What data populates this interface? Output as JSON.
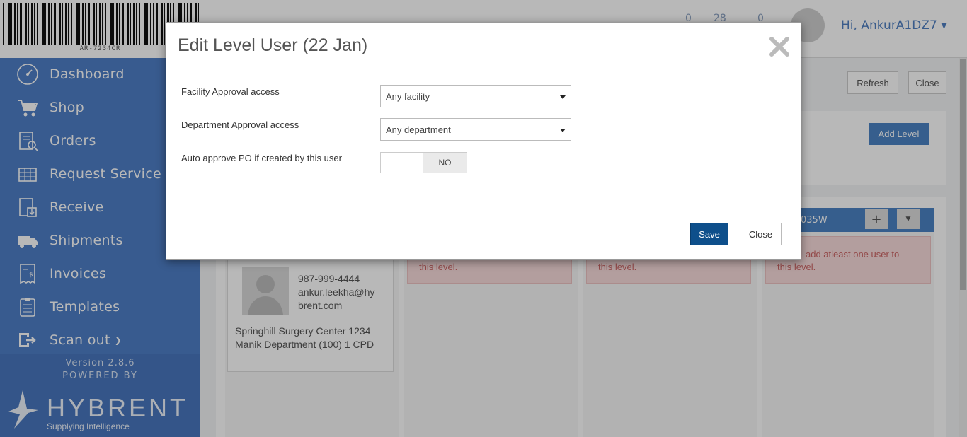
{
  "app": {
    "barcode_text": "AR-7234CR",
    "greeting": "Hi, AnkurA1DZ7 ▾",
    "counts": [
      "0",
      "28",
      "0"
    ],
    "brand_color": "#4e7fc6"
  },
  "sidebar": {
    "items": [
      {
        "label": "Dashboard",
        "icon": "dashboard-icon"
      },
      {
        "label": "Shop",
        "icon": "cart-icon"
      },
      {
        "label": "Orders",
        "icon": "orders-icon"
      },
      {
        "label": "Request Service",
        "icon": "request-service-icon"
      },
      {
        "label": "Receive",
        "icon": "receive-icon"
      },
      {
        "label": "Shipments",
        "icon": "truck-icon"
      },
      {
        "label": "Invoices",
        "icon": "invoice-icon"
      },
      {
        "label": "Templates",
        "icon": "templates-icon"
      },
      {
        "label": "Scan out",
        "icon": "scan-out-icon"
      }
    ],
    "version": "Version 2.8.6",
    "powered_by": "POWERED BY",
    "logo_word": "HYBRENT",
    "logo_tagline": "Supplying Intelligence"
  },
  "page": {
    "refresh_label": "Refresh",
    "close_label": "Close",
    "add_level_label": "Add Level",
    "level_header_partial": "035W",
    "alert_partial_1": "this level.",
    "alert_partial_2": "this level.",
    "alert_3_line1": "add atleast one user to",
    "alert_3_line2": "this level.",
    "user_card": {
      "phone": "987-999-4444",
      "email_line1": "ankur.leekha@hy",
      "email_line2": "brent.com",
      "details": "Springhill Surgery Center 1234 Manik Department (100) 1 CPD"
    }
  },
  "modal": {
    "title": "Edit Level User (22 Jan)",
    "facility_label": "Facility Approval access",
    "facility_value": "Any facility",
    "department_label": "Department Approval access",
    "department_value": "Any department",
    "auto_approve_label": "Auto approve PO if created by this user",
    "toggle_value": "NO",
    "save_label": "Save",
    "close_label": "Close"
  }
}
